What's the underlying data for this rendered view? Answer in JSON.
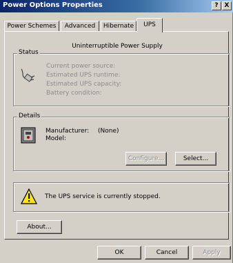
{
  "window": {
    "title": "Power Options Properties",
    "help_glyph": "?",
    "close_glyph": "X"
  },
  "tabs": [
    "Power Schemes",
    "Advanced",
    "Hibernate",
    "UPS"
  ],
  "active_tab": "UPS",
  "ups": {
    "caption": "Uninterruptible Power Supply",
    "status": {
      "title": "Status",
      "rows": [
        "Current power source:",
        "Estimated UPS runtime:",
        "Estimated UPS capacity:",
        "Battery condition:"
      ]
    },
    "details": {
      "title": "Details",
      "manufacturer_label": "Manufacturer:",
      "manufacturer_value": "(None)",
      "model_label": "Model:",
      "configure_label": "Configure...",
      "select_label": "Select..."
    },
    "service_message": "The UPS service is currently stopped.",
    "about_label": "About..."
  },
  "footer": {
    "ok_label": "OK",
    "cancel_label": "Cancel",
    "apply_label": "Apply"
  }
}
